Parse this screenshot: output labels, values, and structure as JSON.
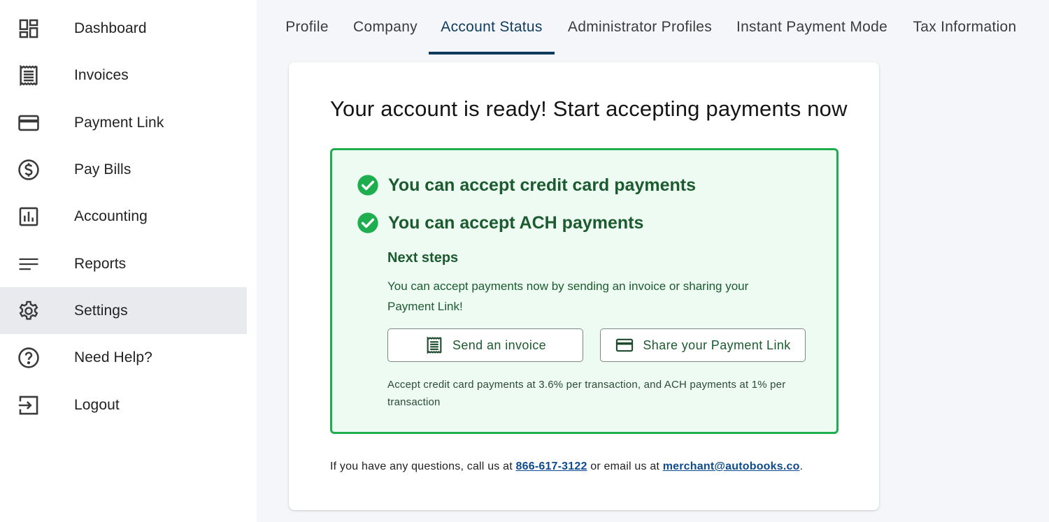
{
  "sidebar": {
    "items": [
      {
        "label": "Dashboard",
        "icon": "dashboard-icon"
      },
      {
        "label": "Invoices",
        "icon": "receipt-icon"
      },
      {
        "label": "Payment Link",
        "icon": "credit-card-icon"
      },
      {
        "label": "Pay Bills",
        "icon": "dollar-circle-icon"
      },
      {
        "label": "Accounting",
        "icon": "bar-chart-icon"
      },
      {
        "label": "Reports",
        "icon": "lines-icon"
      },
      {
        "label": "Settings",
        "icon": "gear-icon",
        "active": true
      },
      {
        "label": "Need Help?",
        "icon": "help-circle-icon"
      },
      {
        "label": "Logout",
        "icon": "logout-icon"
      }
    ]
  },
  "tabs": [
    {
      "label": "Profile"
    },
    {
      "label": "Company"
    },
    {
      "label": "Account Status",
      "active": true
    },
    {
      "label": "Administrator Profiles"
    },
    {
      "label": "Instant Payment Mode"
    },
    {
      "label": "Tax Information"
    }
  ],
  "card": {
    "title": "Your account is ready! Start accepting payments now",
    "status": {
      "credit_card": "You can accept credit card payments",
      "ach": "You can accept ACH payments",
      "next_title": "Next steps",
      "next_desc": "You can accept payments now by sending an invoice or sharing your Payment Link!",
      "send_invoice_label": "Send an invoice",
      "share_link_label": "Share your Payment Link",
      "fee_note": "Accept credit card payments at 3.6% per transaction, and ACH payments at 1% per transaction"
    },
    "contact": {
      "prefix": "If you have any questions, call us at ",
      "phone": "866-617-3122",
      "middle": " or email us at ",
      "email": "merchant@autobooks.co",
      "suffix": "."
    }
  },
  "colors": {
    "accent": "#0e3b5e",
    "success_border": "#1eae4f",
    "success_bg": "#edfbf2",
    "success_text": "#1c5a2f",
    "link": "#0d4b8e"
  }
}
